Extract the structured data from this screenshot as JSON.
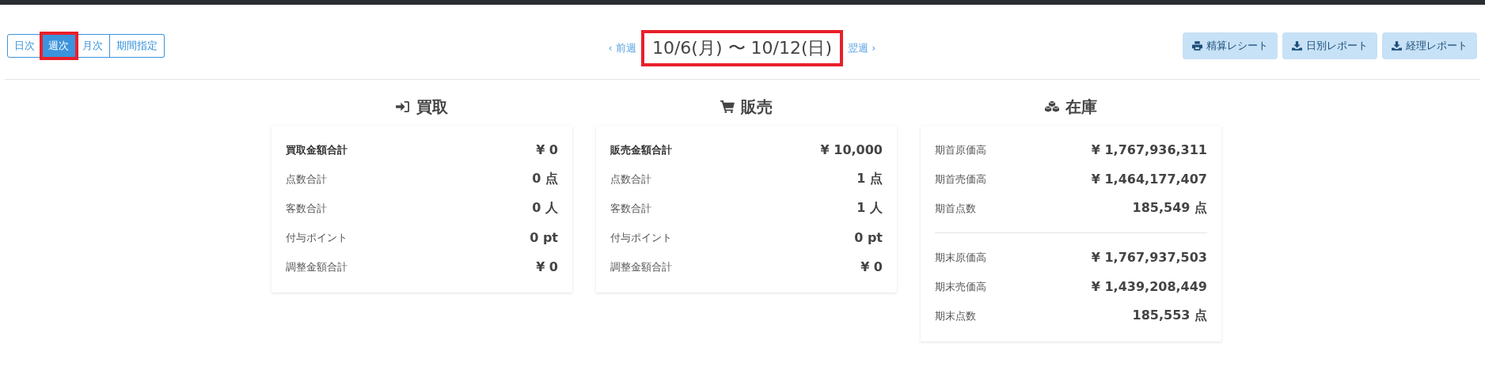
{
  "period_tabs": [
    {
      "label": "日次",
      "selected": false,
      "highlighted": false
    },
    {
      "label": "週次",
      "selected": true,
      "highlighted": true
    },
    {
      "label": "月次",
      "selected": false,
      "highlighted": false
    },
    {
      "label": "期間指定",
      "selected": false,
      "highlighted": false
    }
  ],
  "nav": {
    "prev": "前週",
    "prev_icon": "‹",
    "period": "10/6(月) 〜 10/12(日)",
    "period_highlighted": true,
    "next": "翌週",
    "next_icon": "›"
  },
  "actions": [
    {
      "kind": "print",
      "label": "精算レシート"
    },
    {
      "kind": "download",
      "label": "日別レポート"
    },
    {
      "kind": "download",
      "label": "経理レポート"
    }
  ],
  "sections": [
    {
      "kind": "purchase",
      "title": "買取",
      "groups": [
        [
          {
            "label": "買取金額合計",
            "value": "¥ 0",
            "bold": true
          },
          {
            "label": "点数合計",
            "value": "0 点",
            "bold": false
          },
          {
            "label": "客数合計",
            "value": "0 人",
            "bold": false
          },
          {
            "label": "付与ポイント",
            "value": "0 pt",
            "bold": false
          },
          {
            "label": "調整金額合計",
            "value": "¥ 0",
            "bold": false
          }
        ]
      ]
    },
    {
      "kind": "sales",
      "title": "販売",
      "groups": [
        [
          {
            "label": "販売金額合計",
            "value": "¥ 10,000",
            "bold": true
          },
          {
            "label": "点数合計",
            "value": "1 点",
            "bold": false
          },
          {
            "label": "客数合計",
            "value": "1 人",
            "bold": false
          },
          {
            "label": "付与ポイント",
            "value": "0 pt",
            "bold": false
          },
          {
            "label": "調整金額合計",
            "value": "¥ 0",
            "bold": false
          }
        ]
      ]
    },
    {
      "kind": "inventory",
      "title": "在庫",
      "groups": [
        [
          {
            "label": "期首原価高",
            "value": "¥ 1,767,936,311",
            "bold": false
          },
          {
            "label": "期首売価高",
            "value": "¥ 1,464,177,407",
            "bold": false
          },
          {
            "label": "期首点数",
            "value": "185,549 点",
            "bold": false
          }
        ],
        [
          {
            "label": "期末原価高",
            "value": "¥ 1,767,937,503",
            "bold": false
          },
          {
            "label": "期末売価高",
            "value": "¥ 1,439,208,449",
            "bold": false
          },
          {
            "label": "期末点数",
            "value": "185,553 点",
            "bold": false
          }
        ]
      ]
    }
  ]
}
